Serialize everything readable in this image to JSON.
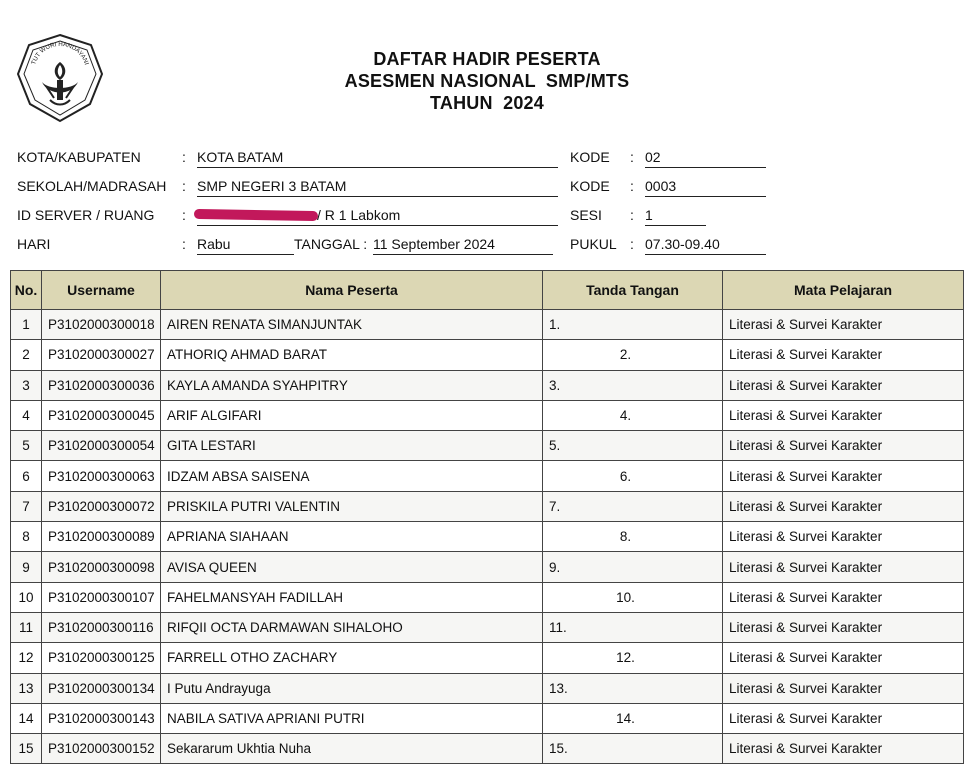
{
  "header": {
    "title_lines": [
      "DAFTAR HADIR PESERTA",
      "ASESMEN NASIONAL  SMP/MTS",
      "TAHUN  2024"
    ],
    "logo_text": "TUT WURI HANDAYANI"
  },
  "info": {
    "kota_label": "KOTA/KABUPATEN",
    "kota_value": "KOTA BATAM",
    "kode1_label": "KODE",
    "kode1_value": "02",
    "sekolah_label": "SEKOLAH/MADRASAH",
    "sekolah_value": "SMP NEGERI 3 BATAM",
    "kode2_label": "KODE",
    "kode2_value": "0003",
    "server_label": "ID SERVER / RUANG",
    "server_value": "/ R 1 Labkom",
    "sesi_label": "SESI",
    "sesi_value": "1",
    "hari_label": "HARI",
    "hari_value": "Rabu",
    "tanggal_label": "TANGGAL :",
    "tanggal_value": "11 September 2024",
    "pukul_label": "PUKUL",
    "pukul_value": "07.30-09.40",
    "colon": ":"
  },
  "table": {
    "headers": [
      "No.",
      "Username",
      "Nama Peserta",
      "Tanda Tangan",
      "Mata Pelajaran"
    ],
    "rows": [
      {
        "no": "1",
        "username": "P3102000300018",
        "nama": "AIREN RENATA SIMANJUNTAK",
        "ttd": "1.",
        "mapel": "Literasi & Survei Karakter"
      },
      {
        "no": "2",
        "username": "P3102000300027",
        "nama": "ATHORIQ AHMAD BARAT",
        "ttd": "2.",
        "mapel": "Literasi & Survei Karakter"
      },
      {
        "no": "3",
        "username": "P3102000300036",
        "nama": "KAYLA AMANDA SYAHPITRY",
        "ttd": "3.",
        "mapel": "Literasi & Survei Karakter"
      },
      {
        "no": "4",
        "username": "P3102000300045",
        "nama": "ARIF ALGIFARI",
        "ttd": "4.",
        "mapel": "Literasi & Survei Karakter"
      },
      {
        "no": "5",
        "username": "P3102000300054",
        "nama": "GITA LESTARI",
        "ttd": "5.",
        "mapel": "Literasi & Survei Karakter"
      },
      {
        "no": "6",
        "username": "P3102000300063",
        "nama": "IDZAM ABSA SAISENA",
        "ttd": "6.",
        "mapel": "Literasi & Survei Karakter"
      },
      {
        "no": "7",
        "username": "P3102000300072",
        "nama": "PRISKILA PUTRI VALENTIN",
        "ttd": "7.",
        "mapel": "Literasi & Survei Karakter"
      },
      {
        "no": "8",
        "username": "P3102000300089",
        "nama": "APRIANA SIAHAAN",
        "ttd": "8.",
        "mapel": "Literasi & Survei Karakter"
      },
      {
        "no": "9",
        "username": "P3102000300098",
        "nama": "AVISA QUEEN",
        "ttd": "9.",
        "mapel": "Literasi & Survei Karakter"
      },
      {
        "no": "10",
        "username": "P3102000300107",
        "nama": "FAHELMANSYAH FADILLAH",
        "ttd": "10.",
        "mapel": "Literasi & Survei Karakter"
      },
      {
        "no": "11",
        "username": "P3102000300116",
        "nama": "RIFQII OCTA DARMAWAN SIHALOHO",
        "ttd": "11.",
        "mapel": "Literasi & Survei Karakter"
      },
      {
        "no": "12",
        "username": "P3102000300125",
        "nama": "FARRELL OTHO ZACHARY",
        "ttd": "12.",
        "mapel": "Literasi & Survei Karakter"
      },
      {
        "no": "13",
        "username": "P3102000300134",
        "nama": "I Putu Andrayuga",
        "ttd": "13.",
        "mapel": "Literasi & Survei Karakter"
      },
      {
        "no": "14",
        "username": "P3102000300143",
        "nama": "NABILA SATIVA APRIANI PUTRI",
        "ttd": "14.",
        "mapel": "Literasi & Survei Karakter"
      },
      {
        "no": "15",
        "username": "P3102000300152",
        "nama": "Sekararum Ukhtia Nuha",
        "ttd": "15.",
        "mapel": "Literasi & Survei Karakter"
      }
    ]
  }
}
